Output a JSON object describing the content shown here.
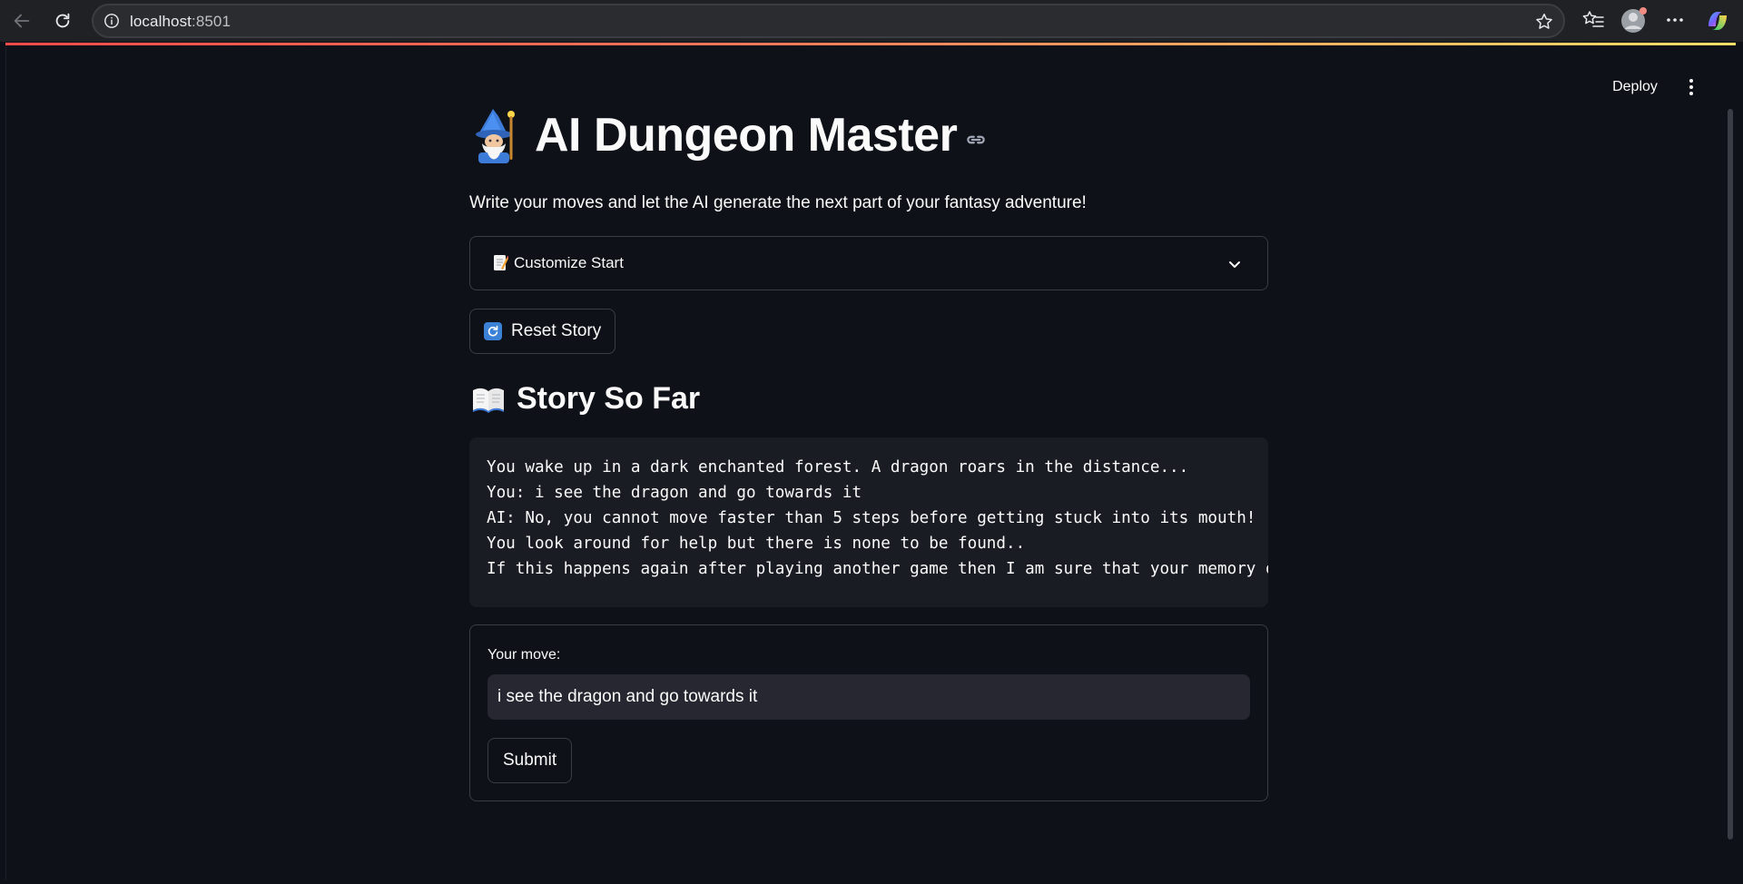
{
  "browser": {
    "url_host": "localhost",
    "url_port": ":8501"
  },
  "toolbar": {
    "deploy_label": "Deploy"
  },
  "app": {
    "title": "AI Dungeon Master",
    "subtitle": "Write your moves and let the AI generate the next part of your fantasy adventure!",
    "expander_label": "Customize Start",
    "reset_label": "Reset Story",
    "story_heading": "Story So Far",
    "story_lines": [
      "You wake up in a dark enchanted forest. A dragon roars in the distance...",
      "You: i see the dragon and go towards it",
      "AI: No, you cannot move faster than 5 steps before getting stuck into its mouth!",
      "You look around for help but there is none to be found..",
      "If this happens again after playing another game then I am sure that your memory o"
    ],
    "form": {
      "label": "Your move:",
      "value": "i see the dragon and go towards it",
      "submit_label": "Submit"
    }
  },
  "colors": {
    "background": "#0e1117",
    "code_background": "#1a1c24",
    "input_background": "#262730",
    "accent_red": "#ff4b4b"
  }
}
